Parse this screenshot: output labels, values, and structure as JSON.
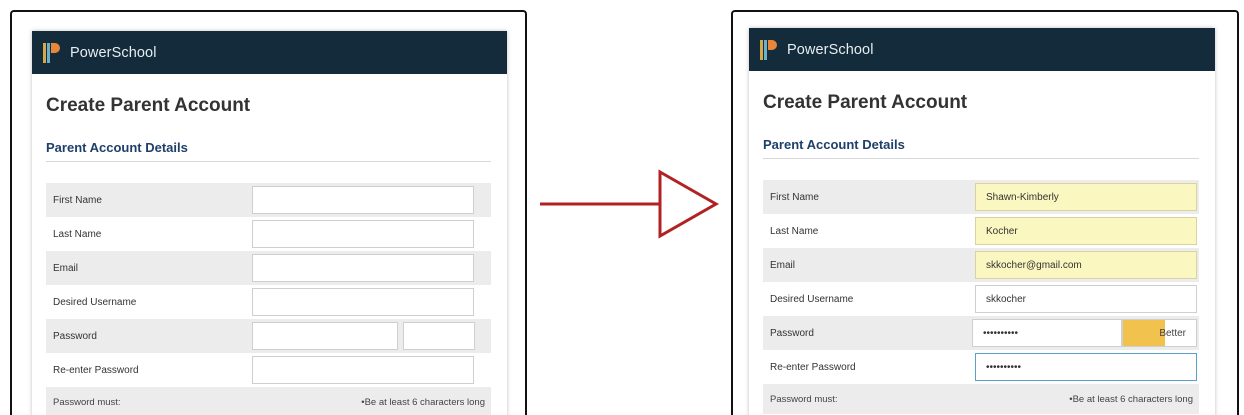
{
  "brand": {
    "name": "PowerSchool"
  },
  "colors": {
    "header_bg": "#132b3a",
    "section_title": "#1f3f6b",
    "autofill": "#fbf7c1",
    "meter": "#f2c24f",
    "arrow": "#b22222"
  },
  "page": {
    "title": "Create Parent Account",
    "section_title": "Parent Account Details",
    "password_must_label": "Password must:",
    "password_rule": "•Be at least 6 characters long"
  },
  "fields": {
    "first_name_label": "First Name",
    "last_name_label": "Last Name",
    "email_label": "Email",
    "username_label": "Desired Username",
    "password_label": "Password",
    "reenter_label": "Re-enter Password"
  },
  "filled": {
    "first_name": "Shawn-Kimberly",
    "last_name": "Kocher",
    "email": "skkocher@gmail.com",
    "username": "skkocher",
    "password": "••••••••••",
    "reenter_password": "••••••••••",
    "strength_label": "Better",
    "strength_level": 0.58
  },
  "icons": {
    "arrow": "right-arrow-icon",
    "logo": "powerschool-logo-icon"
  }
}
